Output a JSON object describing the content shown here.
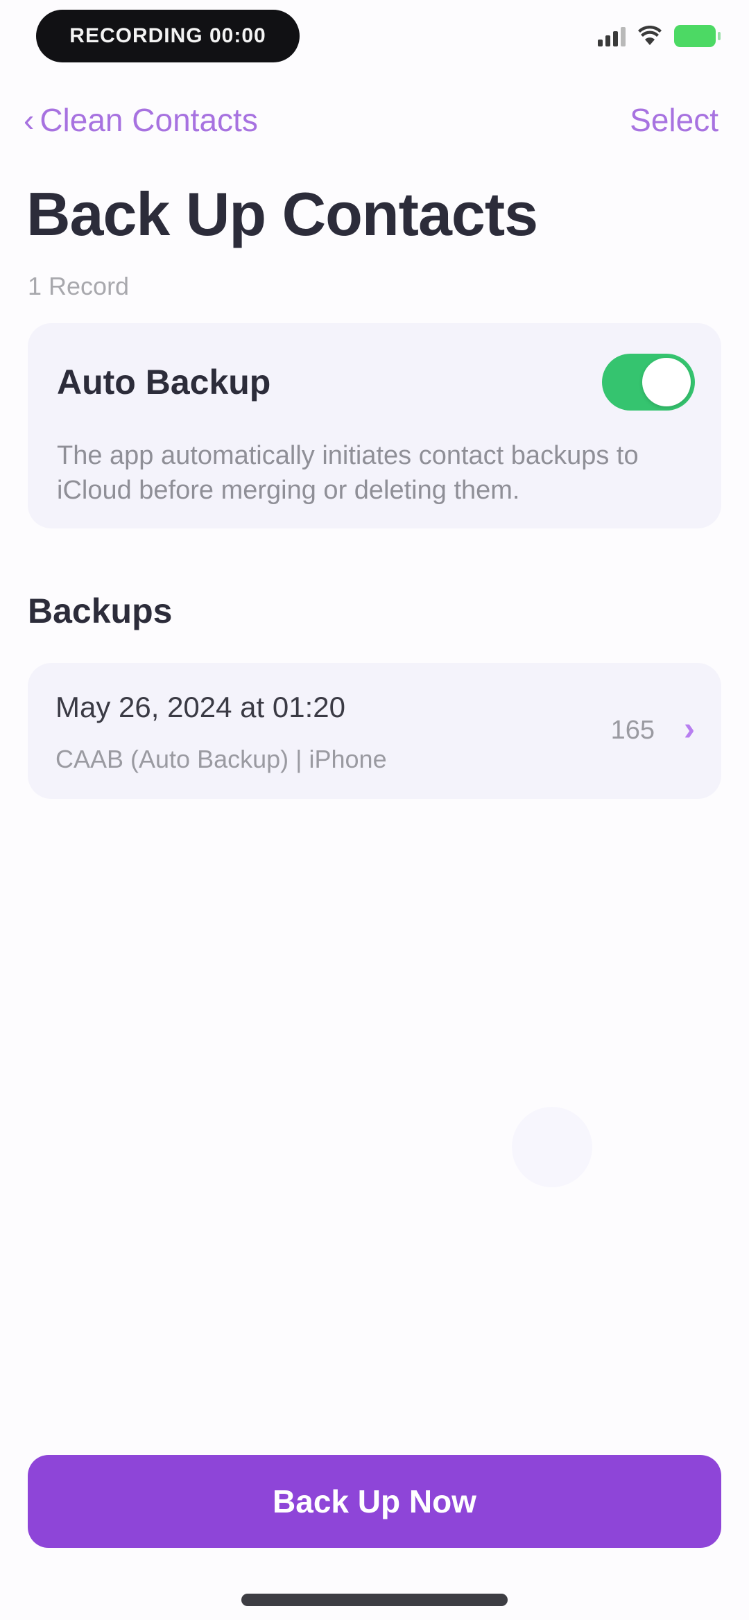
{
  "status_bar": {
    "recording_label": "RECORDING 00:00",
    "battery_color": "#4cd964"
  },
  "navbar": {
    "back_label": "Clean Contacts",
    "back_icon": "chevron-left-icon",
    "select_label": "Select"
  },
  "title": "Back Up Contacts",
  "subtitle": "1 Record",
  "auto_backup": {
    "title": "Auto Backup",
    "enabled": true,
    "description": "The app automatically initiates contact backups to iCloud before merging or deleting them."
  },
  "backups_section": {
    "header": "Backups",
    "items": [
      {
        "date": "May 26, 2024 at 01:20",
        "meta": "CAAB (Auto Backup) | iPhone",
        "count": "165"
      }
    ]
  },
  "primary_button": {
    "label": "Back Up Now",
    "color": "#8e45d8"
  },
  "colors": {
    "accent": "#a772e0",
    "toggle_on": "#35c46f",
    "card_bg": "#f4f3fb"
  }
}
